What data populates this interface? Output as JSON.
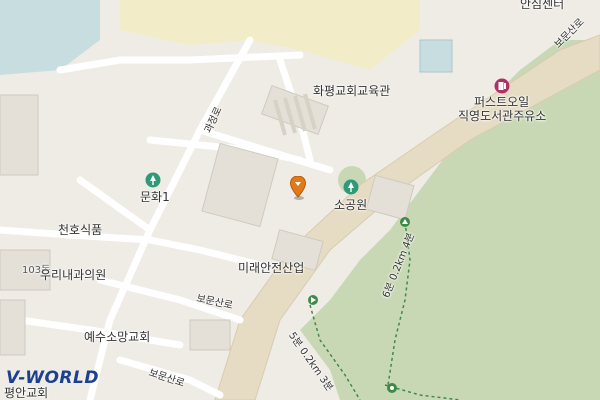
{
  "map": {
    "labels": {
      "top_right": "안심센터",
      "education_hall": "화평교회교육관",
      "gas_station_1": "퍼스트오일",
      "gas_station_2": "직영도서관주유소",
      "munhwa": "문화1",
      "sogong": "소공원",
      "cheonho": "천호식품",
      "building_103": "103동",
      "dental": "우리내과의원",
      "mirae": "미래안전산업",
      "yesu_church": "예수소망교회",
      "pyeongan_church": "평안교회",
      "road_gwajeong": "과정로",
      "road_boeun_1": "보문산로",
      "road_boeun_2": "보문산로",
      "road_boeun_3": "보문산로",
      "trail_1": "6분 0.2km 4분",
      "trail_2": "5분 0.2km 3분"
    },
    "logo": {
      "v": "V",
      "rest": "-WORLD"
    },
    "colors": {
      "background": "#efece6",
      "main_road": "#e6dcc4",
      "forest": "#c9d8b4",
      "trail": "#3f8a4a",
      "water": "#c8dde0",
      "poi_green": "#2e9a7a",
      "poi_purple": "#b0306a",
      "pin": "#e07a1a"
    }
  }
}
